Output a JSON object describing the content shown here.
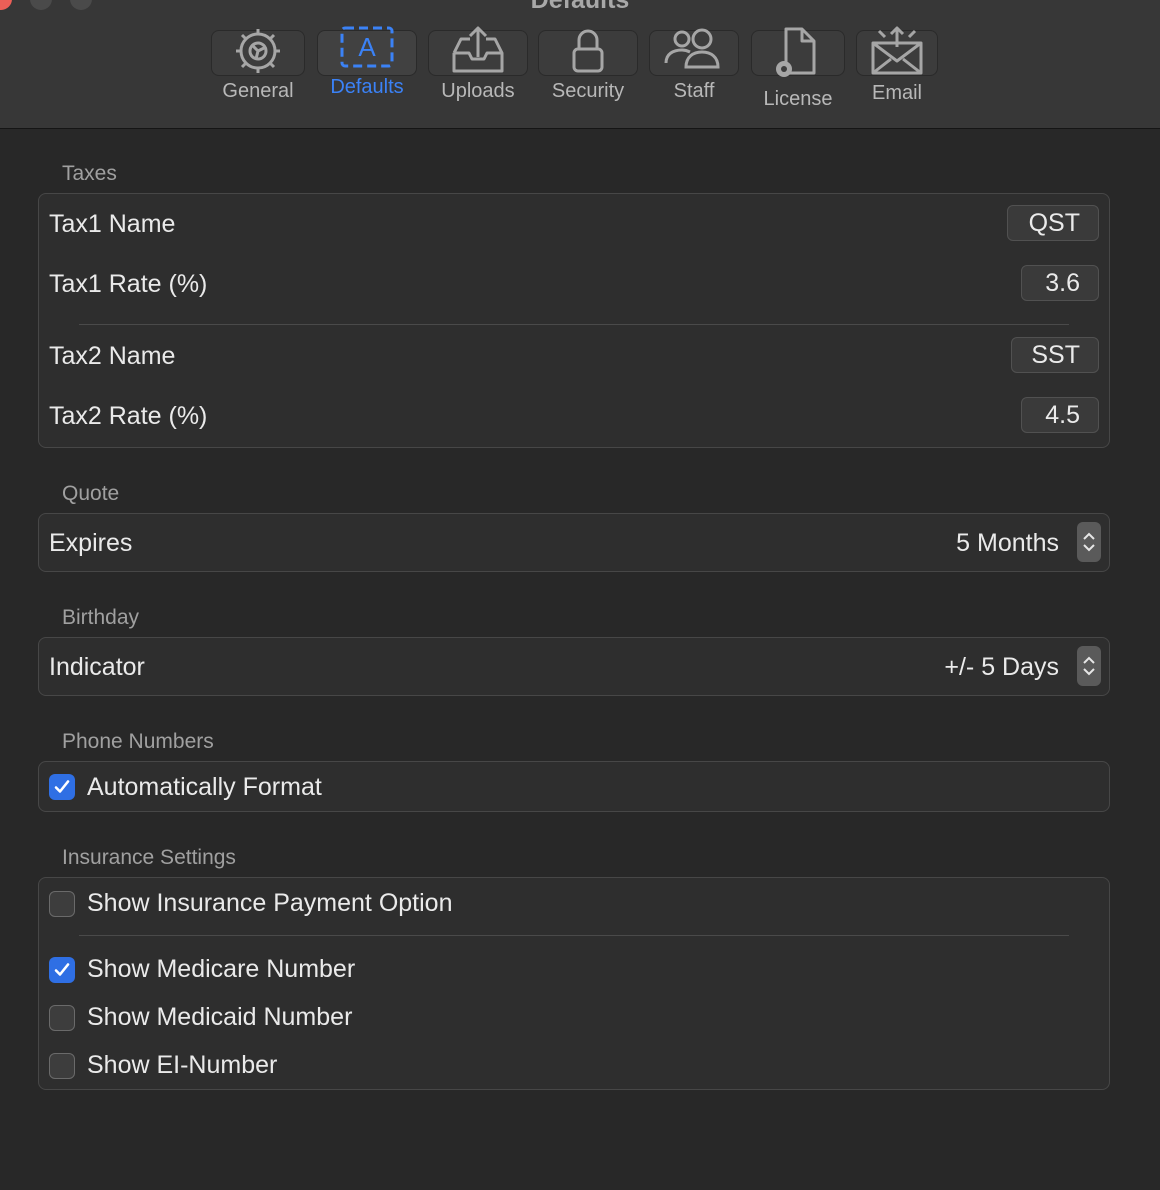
{
  "window": {
    "title": "Defaults"
  },
  "toolbar": {
    "tabs": [
      {
        "label": "General",
        "icon": "gear-icon"
      },
      {
        "label": "Defaults",
        "icon": "text-box-icon",
        "selected": true
      },
      {
        "label": "Uploads",
        "icon": "upload-tray-icon"
      },
      {
        "label": "Security",
        "icon": "lock-icon"
      },
      {
        "label": "Staff",
        "icon": "people-icon"
      },
      {
        "label": "License",
        "icon": "document-gear-icon"
      },
      {
        "label": "Email",
        "icon": "envelope-icon"
      }
    ],
    "accent_color": "#3b82f6"
  },
  "taxes": {
    "title": "Taxes",
    "tax1_name_label": "Tax1 Name",
    "tax1_name_value": "QST",
    "tax1_rate_label": "Tax1 Rate (%)",
    "tax1_rate_value": "3.6",
    "tax2_name_label": "Tax2 Name",
    "tax2_name_value": "SST",
    "tax2_rate_label": "Tax2 Rate (%)",
    "tax2_rate_value": "4.5"
  },
  "quote": {
    "title": "Quote",
    "expires_label": "Expires",
    "expires_value": "5 Months"
  },
  "birthday": {
    "title": "Birthday",
    "indicator_label": "Indicator",
    "indicator_value": "+/- 5 Days"
  },
  "phone": {
    "title": "Phone Numbers",
    "auto_format_label": "Automatically Format",
    "auto_format_checked": true
  },
  "insurance": {
    "title": "Insurance Settings",
    "options": [
      {
        "label": "Show Insurance Payment Option",
        "checked": false
      },
      {
        "label": "Show Medicare Number",
        "checked": true
      },
      {
        "label": "Show Medicaid Number",
        "checked": false
      },
      {
        "label": "Show EI-Number",
        "checked": false
      }
    ]
  }
}
